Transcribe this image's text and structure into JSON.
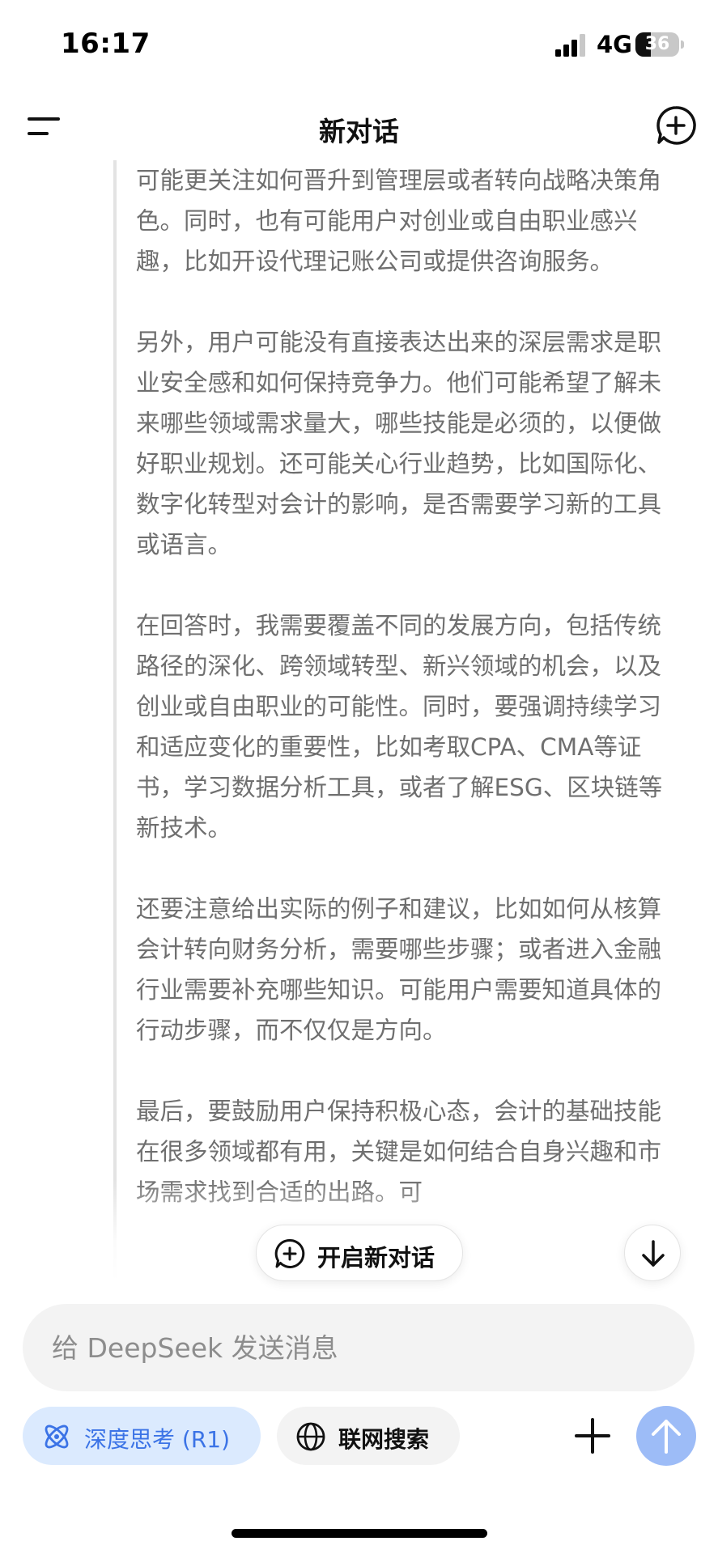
{
  "status_bar": {
    "time": "16:17",
    "network": "4G",
    "battery": "36",
    "battery_level": 0.36
  },
  "header": {
    "title": "新对话",
    "menu_icon": "menu-icon",
    "new_chat_icon": "new-chat-icon"
  },
  "thinking": {
    "paragraphs": [
      "可能更关注如何晋升到管理层或者转向战略决策角色。同时，也有可能用户对创业或自由职业感兴趣，比如开设代理记账公司或提供咨询服务。",
      "另外，用户可能没有直接表达出来的深层需求是职业安全感和如何保持竞争力。他们可能希望了解未来哪些领域需求量大，哪些技能是必须的，以便做好职业规划。还可能关心行业趋势，比如国际化、数字化转型对会计的影响，是否需要学习新的工具或语言。",
      "在回答时，我需要覆盖不同的发展方向，包括传统路径的深化、跨领域转型、新兴领域的机会，以及创业或自由职业的可能性。同时，要强调持续学习和适应变化的重要性，比如考取CPA、CMA等证书，学习数据分析工具，或者了解ESG、区块链等新技术。",
      "还要注意给出实际的例子和建议，比如如何从核算会计转向财务分析，需要哪些步骤；或者进入金融行业需要补充哪些知识。可能用户需要知道具体的行动步骤，而不仅仅是方向。",
      "最后，要鼓励用户保持积极心态，会计的基础技能在很多领域都有用，关键是如何结合自身兴趣和市场需求找到合适的出路。可"
    ]
  },
  "floating": {
    "new_chat_label": "开启新对话",
    "scroll_down_icon": "arrow-down-icon"
  },
  "composer": {
    "placeholder": "给 DeepSeek 发送消息",
    "value": ""
  },
  "toolbar": {
    "deep_think_label": "深度思考 (R1)",
    "web_search_label": "联网搜索",
    "attach_icon": "plus-icon",
    "send_icon": "arrow-up-icon"
  },
  "colors": {
    "accent": "#3b73e6",
    "accent_bg": "#dbeafe",
    "send_disabled": "#9dbcf7",
    "thinking_text": "#6f6f6f"
  }
}
